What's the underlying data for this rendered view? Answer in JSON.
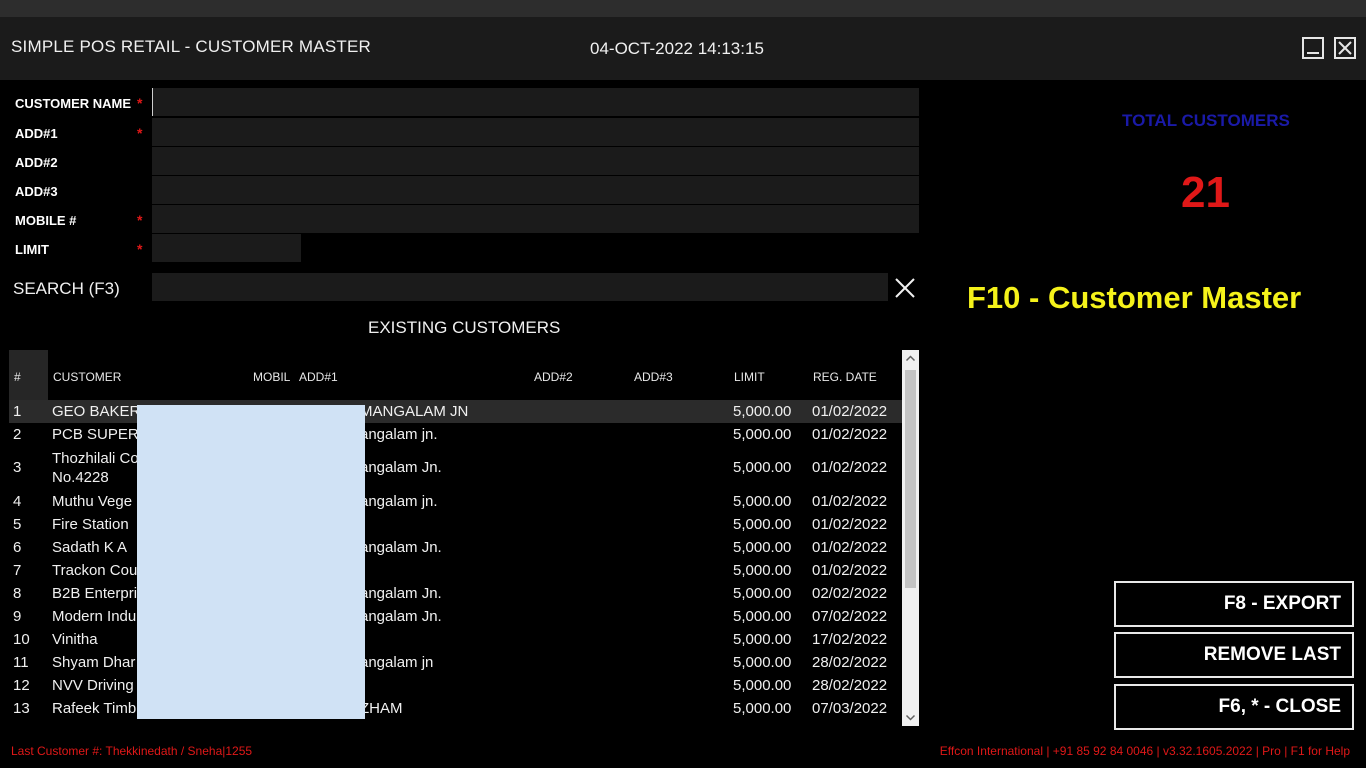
{
  "window": {
    "title": "SIMPLE POS RETAIL - CUSTOMER MASTER",
    "datetime": "04-OCT-2022 14:13:15"
  },
  "form": {
    "fields": [
      {
        "label": "CUSTOMER NAME",
        "required": true,
        "value": ""
      },
      {
        "label": "ADD#1",
        "required": true,
        "value": ""
      },
      {
        "label": "ADD#2",
        "required": false,
        "value": ""
      },
      {
        "label": "ADD#3",
        "required": false,
        "value": ""
      },
      {
        "label": "MOBILE #",
        "required": true,
        "value": ""
      },
      {
        "label": "LIMIT",
        "required": true,
        "value": ""
      }
    ],
    "required_mark": "*"
  },
  "search": {
    "label": "SEARCH (F3)",
    "value": "",
    "clear_icon": "close-icon"
  },
  "customers": {
    "section_title": "EXISTING CUSTOMERS",
    "columns": [
      "#",
      "CUSTOMER",
      "MOBIL",
      "ADD#1",
      "ADD#2",
      "ADD#3",
      "LIMIT",
      "REG. DATE"
    ],
    "rows": [
      {
        "no": "1",
        "customer": "GEO BAKERY",
        "add1": "MANGALAM JN",
        "limit": "5,000.00",
        "date": "01/02/2022"
      },
      {
        "no": "2",
        "customer": "PCB SUPERM",
        "add1": "angalam jn.",
        "limit": "5,000.00",
        "date": "01/02/2022"
      },
      {
        "no": "3",
        "customer": "Thozhilali Co No.4228",
        "add1": "angalam Jn.",
        "limit": "5,000.00",
        "date": "01/02/2022"
      },
      {
        "no": "4",
        "customer": "Muthu Vege",
        "add1": "angalam jn.",
        "limit": "5,000.00",
        "date": "01/02/2022"
      },
      {
        "no": "5",
        "customer": "Fire Station",
        "add1": "",
        "limit": "5,000.00",
        "date": "01/02/2022"
      },
      {
        "no": "6",
        "customer": "Sadath K A",
        "add1": "angalam Jn.",
        "limit": "5,000.00",
        "date": "01/02/2022"
      },
      {
        "no": "7",
        "customer": "Trackon Cou",
        "add1": "",
        "limit": "5,000.00",
        "date": "01/02/2022"
      },
      {
        "no": "8",
        "customer": "B2B Enterpri",
        "add1": "angalam Jn.",
        "limit": "5,000.00",
        "date": "02/02/2022"
      },
      {
        "no": "9",
        "customer": "Modern Indu",
        "add1": "angalam Jn.",
        "limit": "5,000.00",
        "date": "07/02/2022"
      },
      {
        "no": "10",
        "customer": "Vinitha",
        "add1": "",
        "limit": "5,000.00",
        "date": "17/02/2022"
      },
      {
        "no": "11",
        "customer": "Shyam Dhar",
        "add1": "angalam jn",
        "limit": "5,000.00",
        "date": "28/02/2022"
      },
      {
        "no": "12",
        "customer": "NVV Driving",
        "add1": "",
        "limit": "5,000.00",
        "date": "28/02/2022"
      },
      {
        "no": "13",
        "customer": "Rafeek Timb",
        "add1": "ZHAM",
        "limit": "5,000.00",
        "date": "07/03/2022"
      }
    ],
    "selected_row": 0
  },
  "stats": {
    "total_label": "TOTAL CUSTOMERS",
    "total_count": "21",
    "mode_label": "F10 - Customer Master"
  },
  "actions": {
    "export": "F8 - EXPORT",
    "remove_last": "REMOVE LAST",
    "close": "F6, * - CLOSE"
  },
  "footer": {
    "last_customer": "Last Customer #: Thekkinedath / Sneha|1255",
    "info": "Effcon International | +91 85 92 84 0046 | v3.32.1605.2022 | Pro | F1 for Help"
  },
  "colors": {
    "background": "#000000",
    "titlebar": "#1b1b1b",
    "input_bg": "#1b1b1b",
    "required": "#e01818",
    "total_label": "#1a1aa8",
    "total_count": "#e01818",
    "mode_label": "#f5f21a",
    "footer_text": "#e01818"
  }
}
